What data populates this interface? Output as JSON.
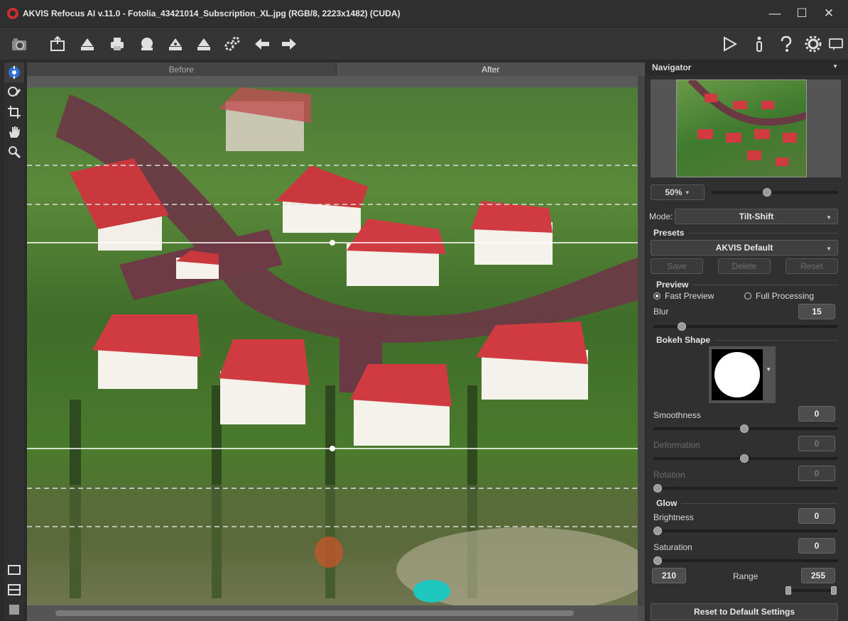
{
  "window": {
    "title": "AKVIS Refocus AI v.11.0 - Fotolia_43421014_Subscription_XL.jpg (RGB/8, 2223x1482) (CUDA)",
    "minimize": "—",
    "maximize": "☐",
    "close": "✕"
  },
  "toolbar": {
    "icons": [
      "camera-icon",
      "open-icon",
      "save-icon",
      "print-icon",
      "share-icon",
      "batch-icon",
      "export-icon",
      "plugins-icon",
      "undo-icon",
      "redo-icon"
    ],
    "right_icons": [
      "run-icon",
      "info-icon",
      "help-icon",
      "settings-icon",
      "feedback-icon"
    ]
  },
  "tools": [
    "tilt-shift-tool",
    "brush-tool",
    "crop-tool",
    "hand-tool",
    "zoom-tool"
  ],
  "view_tabs": {
    "before": "Before",
    "after": "After"
  },
  "navigator": {
    "title": "Navigator",
    "zoom": "50%"
  },
  "settings": {
    "mode_label": "Mode:",
    "mode_value": "Tilt-Shift",
    "presets_label": "Presets",
    "preset_value": "AKVIS Default",
    "save": "Save",
    "delete": "Delete",
    "reset": "Reset",
    "preview_label": "Preview",
    "fast_preview": "Fast Preview",
    "full_processing": "Full Processing",
    "blur_label": "Blur",
    "blur_value": "15",
    "bokeh_label": "Bokeh Shape",
    "smoothness_label": "Smoothness",
    "smoothness_value": "0",
    "deformation_label": "Deformation",
    "deformation_value": "0",
    "rotation_label": "Rotation",
    "rotation_value": "0",
    "glow_label": "Glow",
    "brightness_label": "Brightness",
    "brightness_value": "0",
    "saturation_label": "Saturation",
    "saturation_value": "0",
    "range_label": "Range",
    "range_min": "210",
    "range_max": "255",
    "reset_default": "Reset to Default Settings"
  },
  "colors": {
    "accent": "#2f6fcf",
    "panel": "#303030",
    "canvas": "#4d4d4d"
  }
}
